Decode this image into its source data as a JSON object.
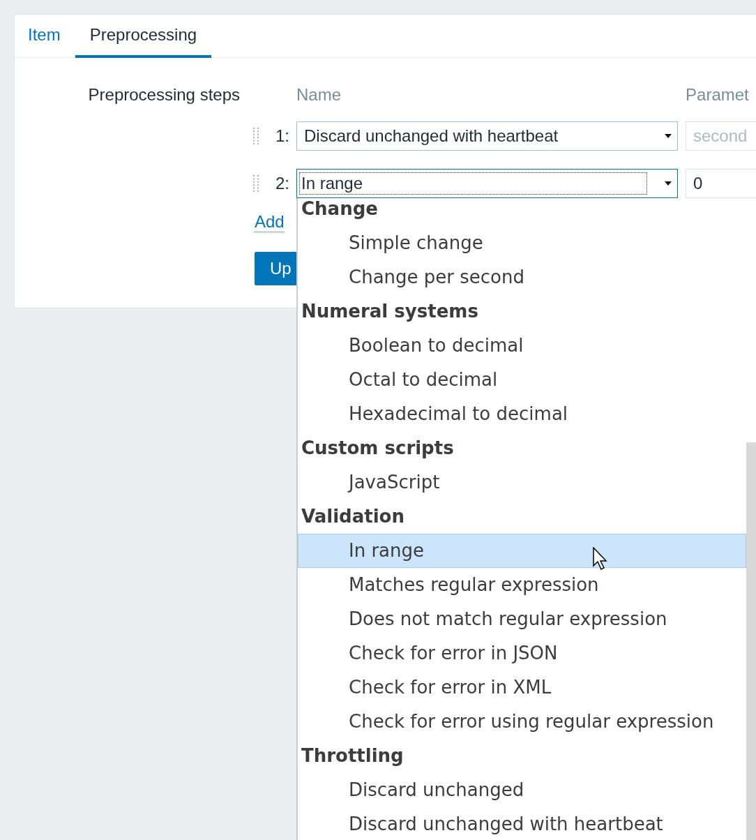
{
  "tabs": [
    {
      "label": "Item",
      "selected": false
    },
    {
      "label": "Preprocessing",
      "selected": true
    }
  ],
  "form": {
    "label": "Preprocessing steps",
    "columns": [
      "Name",
      "Paramet"
    ],
    "steps": [
      {
        "number": "1:",
        "name": "Discard unchanged with heartbeat",
        "focused": false,
        "parameter": {
          "placeholder": "second"
        }
      },
      {
        "number": "2:",
        "name": "In range",
        "focused": true,
        "parameter": {
          "value": "0"
        }
      }
    ],
    "add_link": "Add",
    "update_button": "Up"
  },
  "dropdown": {
    "groups": [
      {
        "label": "Change",
        "options": [
          {
            "label": "Simple change",
            "selected": false
          },
          {
            "label": "Change per second",
            "selected": false
          }
        ]
      },
      {
        "label": "Numeral systems",
        "options": [
          {
            "label": "Boolean to decimal",
            "selected": false
          },
          {
            "label": "Octal to decimal",
            "selected": false
          },
          {
            "label": "Hexadecimal to decimal",
            "selected": false
          }
        ]
      },
      {
        "label": "Custom scripts",
        "options": [
          {
            "label": "JavaScript",
            "selected": false
          }
        ]
      },
      {
        "label": "Validation",
        "options": [
          {
            "label": "In range",
            "selected": true
          },
          {
            "label": "Matches regular expression",
            "selected": false
          },
          {
            "label": "Does not match regular expression",
            "selected": false
          },
          {
            "label": "Check for error in JSON",
            "selected": false
          },
          {
            "label": "Check for error in XML",
            "selected": false
          },
          {
            "label": "Check for error using regular expression",
            "selected": false
          }
        ]
      },
      {
        "label": "Throttling",
        "options": [
          {
            "label": "Discard unchanged",
            "selected": false
          },
          {
            "label": "Discard unchanged with heartbeat",
            "selected": false
          }
        ]
      }
    ]
  }
}
